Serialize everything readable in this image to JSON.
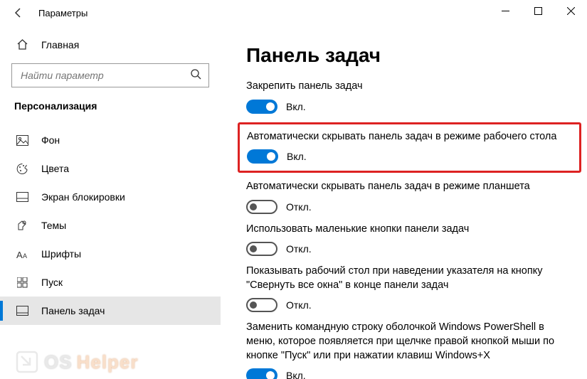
{
  "titlebar": {
    "title": "Параметры"
  },
  "sidebar": {
    "home_label": "Главная",
    "search_placeholder": "Найти параметр",
    "category": "Персонализация",
    "items": [
      {
        "label": "Фон"
      },
      {
        "label": "Цвета"
      },
      {
        "label": "Экран блокировки"
      },
      {
        "label": "Темы"
      },
      {
        "label": "Шрифты"
      },
      {
        "label": "Пуск"
      },
      {
        "label": "Панель задач"
      }
    ]
  },
  "page": {
    "heading": "Панель задач",
    "settings": [
      {
        "label": "Закрепить панель задач",
        "on": true,
        "state": "Вкл."
      },
      {
        "label": "Автоматически скрывать панель задач в режиме рабочего стола",
        "on": true,
        "state": "Вкл.",
        "highlighted": true
      },
      {
        "label": "Автоматически скрывать панель задач в режиме планшета",
        "on": false,
        "state": "Откл."
      },
      {
        "label": "Использовать маленькие кнопки панели задач",
        "on": false,
        "state": "Откл."
      },
      {
        "label": "Показывать рабочий стол при наведении указателя на кнопку \"Свернуть все окна\" в конце панели задач",
        "on": false,
        "state": "Откл."
      },
      {
        "label": "Заменить командную строку оболочкой Windows PowerShell в меню, которое появляется при щелчке правой кнопкой мыши по кнопке \"Пуск\" или при нажатии клавиш Windows+X",
        "on": true,
        "state": "Вкл."
      }
    ]
  },
  "watermark": {
    "os": "OS",
    "helper": "Helper"
  }
}
